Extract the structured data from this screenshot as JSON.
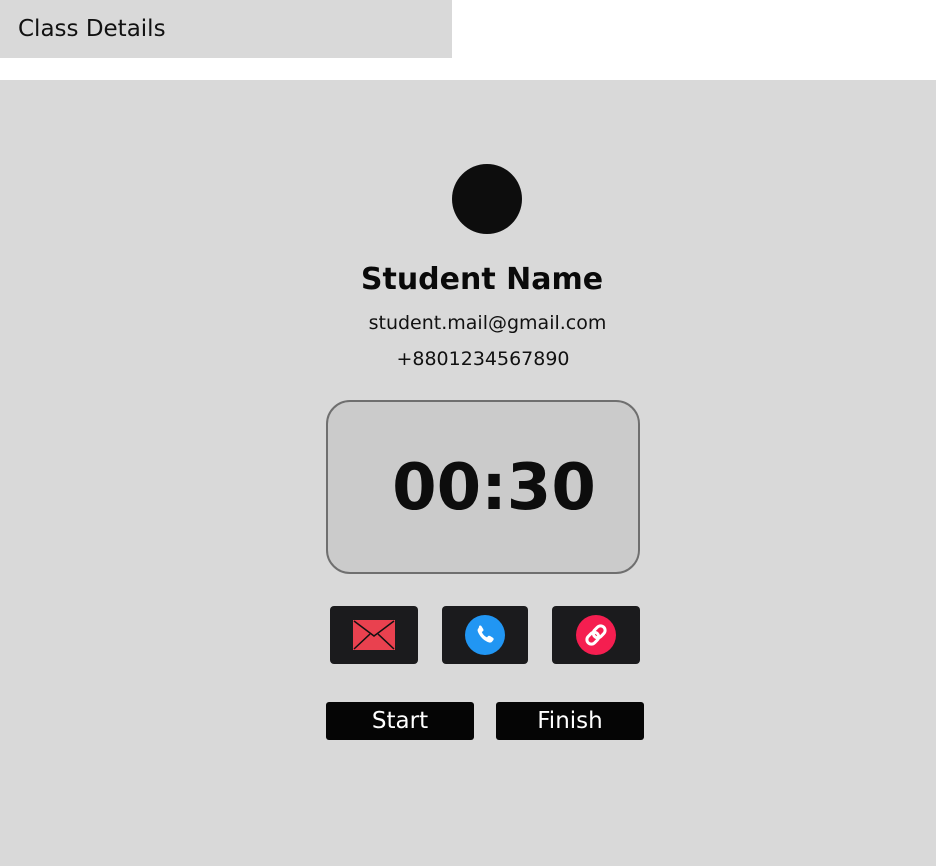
{
  "header": {
    "title": "Class Details"
  },
  "student": {
    "name": "Student Name",
    "email": "student.mail@gmail.com",
    "phone": "+8801234567890"
  },
  "timer": {
    "value": "00:30"
  },
  "actions": [
    {
      "icon": "mail-icon",
      "color": "#e9414f"
    },
    {
      "icon": "phone-icon",
      "color": "#2196f3"
    },
    {
      "icon": "link-icon",
      "color": "#f51e50"
    }
  ],
  "controls": {
    "start_label": "Start",
    "finish_label": "Finish"
  },
  "colors": {
    "panel_bg": "#d9d9d9",
    "timer_bg": "#cbcbcb",
    "button_bg": "#1b1b1d",
    "control_bg": "#050505"
  }
}
